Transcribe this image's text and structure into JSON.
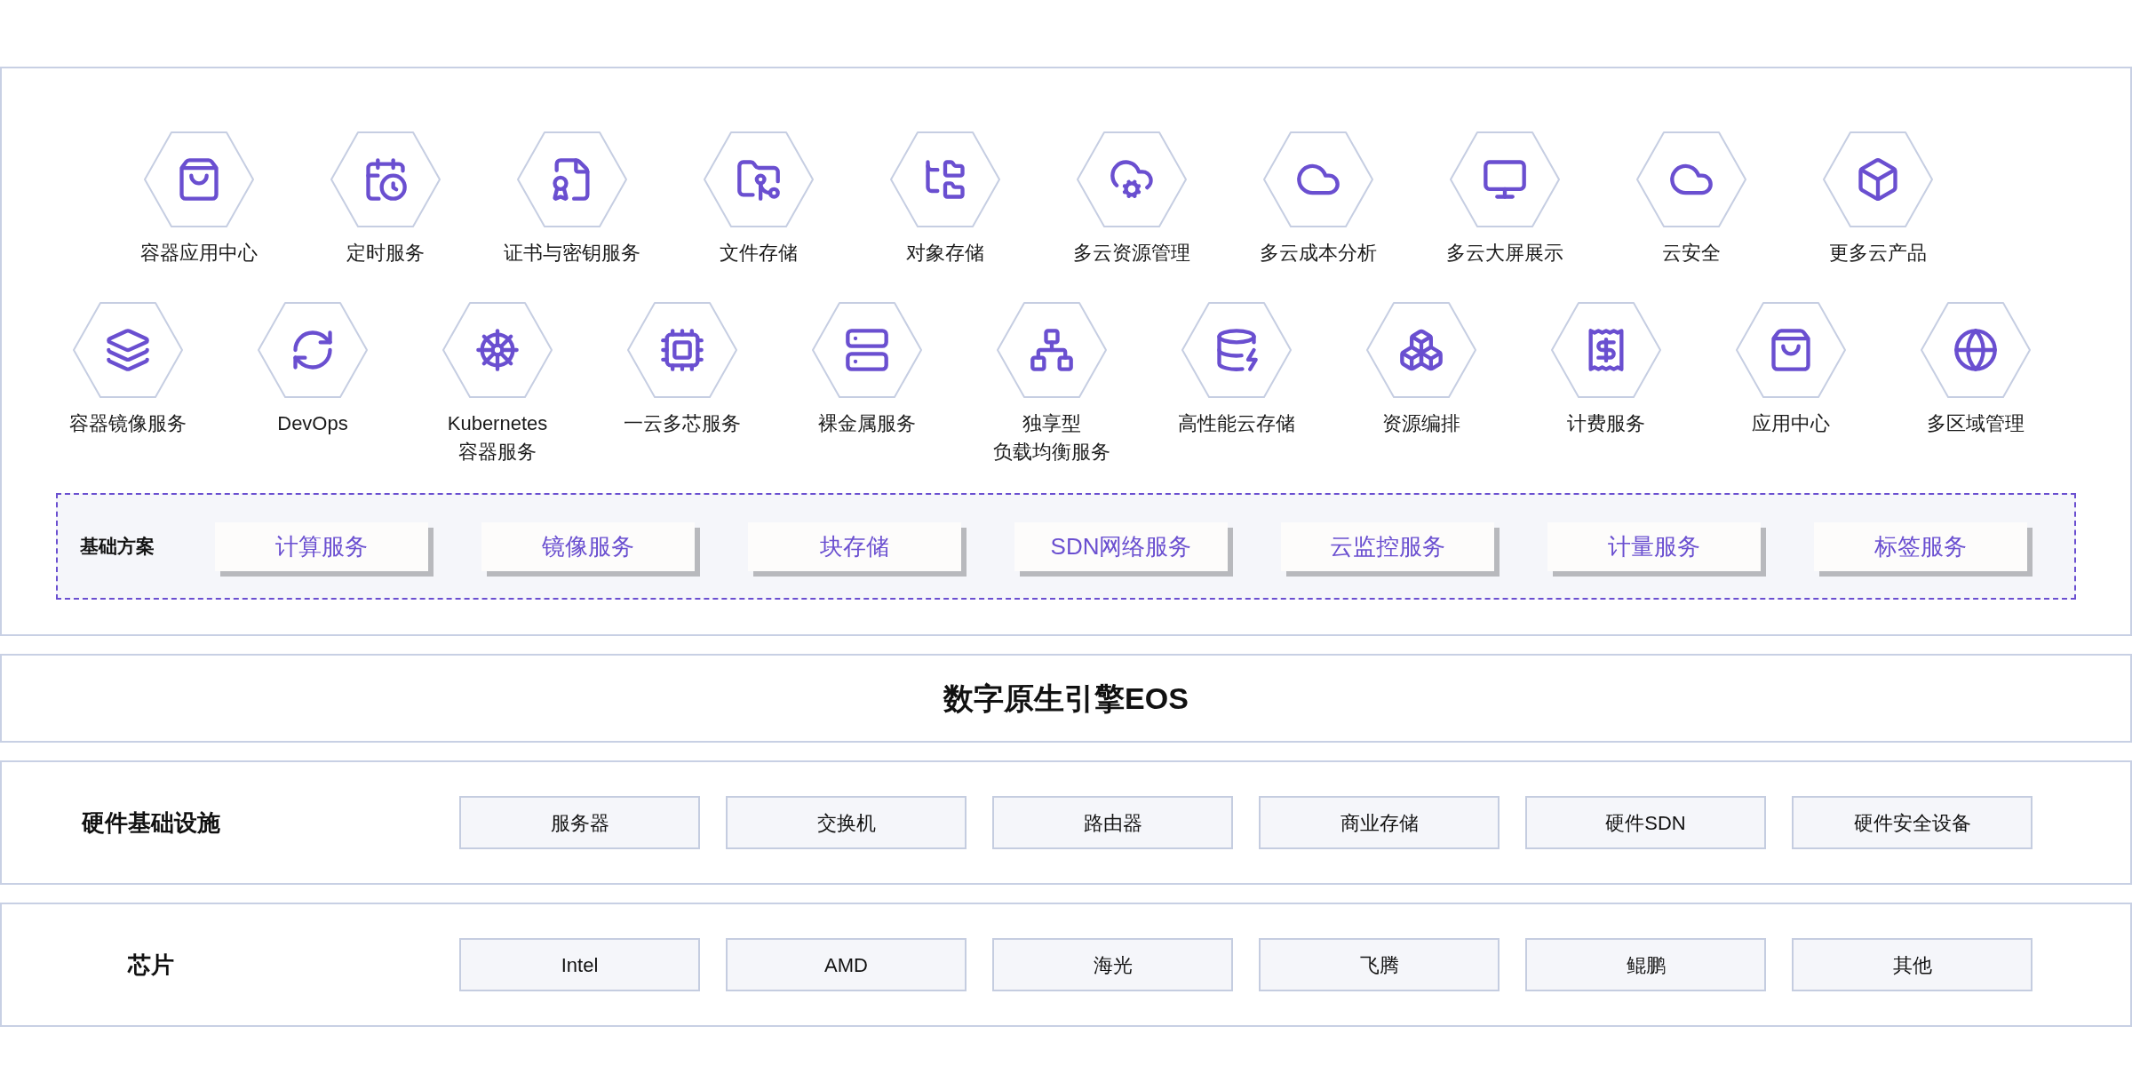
{
  "products": {
    "rows": [
      [
        {
          "label": "容器应用中心"
        },
        {
          "label": "定时服务"
        },
        {
          "label": "证书与密钥服务"
        },
        {
          "label": "文件存储"
        },
        {
          "label": "对象存储"
        },
        {
          "label": "多云资源管理"
        },
        {
          "label": "多云成本分析"
        },
        {
          "label": "多云大屏展示"
        },
        {
          "label": "云安全"
        },
        {
          "label": "更多云产品"
        }
      ],
      [
        {
          "label": "容器镜像服务"
        },
        {
          "label": "DevOps"
        },
        {
          "label": "Kubernetes",
          "label_2": "容器服务"
        },
        {
          "label": "一云多芯服务"
        },
        {
          "label": "裸金属服务"
        },
        {
          "label": "独享型",
          "label_2": "负载均衡服务"
        },
        {
          "label": "高性能云存储"
        },
        {
          "label": "资源编排"
        },
        {
          "label": "计费服务"
        },
        {
          "label": "应用中心"
        },
        {
          "label": "多区域管理"
        }
      ]
    ]
  },
  "foundation": {
    "title": "基础方案",
    "items": [
      "计算服务",
      "镜像服务",
      "块存储",
      "SDN网络服务",
      "云监控服务",
      "计量服务",
      "标签服务"
    ]
  },
  "engine": {
    "title": "数字原生引擎EOS"
  },
  "layers": [
    {
      "title": "硬件基础设施",
      "items": [
        "服务器",
        "交换机",
        "路由器",
        "商业存储",
        "硬件SDN",
        "硬件安全设备"
      ]
    },
    {
      "title": "芯片",
      "items": [
        "Intel",
        "AMD",
        "海光",
        "飞腾",
        "鲲鹏",
        "其他"
      ]
    }
  ]
}
